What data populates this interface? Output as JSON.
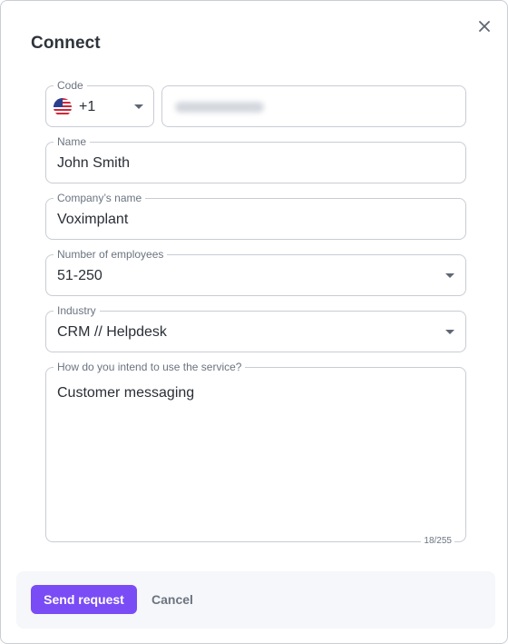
{
  "dialog": {
    "title": "Connect",
    "close_icon": "close-icon"
  },
  "form": {
    "code": {
      "label": "Code",
      "value": "+1",
      "flag_icon": "us-flag-icon"
    },
    "phone": {
      "value": ""
    },
    "name": {
      "label": "Name",
      "value": "John Smith"
    },
    "company": {
      "label": "Company’s name",
      "value": "Voximplant"
    },
    "employees": {
      "label": "Number of employees",
      "value": "51-250"
    },
    "industry": {
      "label": "Industry",
      "value": "CRM // Helpdesk"
    },
    "usage": {
      "label": "How do you intend to use the service?",
      "value": "Customer messaging",
      "counter": "18/255"
    }
  },
  "footer": {
    "send_label": "Send request",
    "cancel_label": "Cancel"
  },
  "colors": {
    "primary": "#7a4cf5",
    "border": "#c8ccd3",
    "muted_text": "#6b7480",
    "footer_bg": "#f6f7fa"
  }
}
